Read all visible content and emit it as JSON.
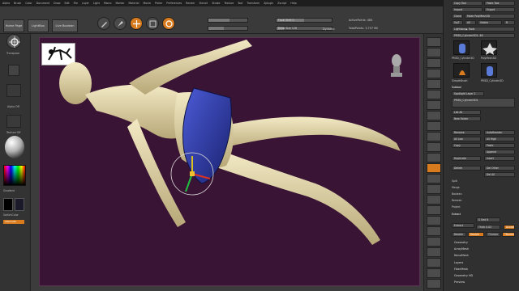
{
  "menubar": {
    "items": [
      "Alpha",
      "Brush",
      "Color",
      "Document",
      "Draw",
      "Edit",
      "File",
      "Layer",
      "Light",
      "Macro",
      "Marker",
      "Material",
      "Movie",
      "Picker",
      "Preferences",
      "Render",
      "Stencil",
      "Stroke",
      "Texture",
      "Tool",
      "Transform",
      "Zplugin",
      "Zscript",
      "Help"
    ]
  },
  "topbar": {
    "home_page": "Home Page",
    "lightbox": "LightBox",
    "live_boolean": "Live Boolean",
    "focal_shift_label": "Focal Shift 0",
    "focal_shift_value": 0,
    "draw_size_label": "Draw Size 128",
    "draw_size_fraction": 0.13,
    "dynamic_label": "Dynamic",
    "active_points": "ActivePoints: 484",
    "total_points": "TotalPoints: 3.757 Mil"
  },
  "left_shelf": {
    "transpose_label": "Transpose",
    "alpha_off": "Alpha Off",
    "texture_off": "Texture Off",
    "gradient_label": "Gradient",
    "switch_color": "SwitchColor",
    "alternate": "Alternate"
  },
  "right_tray": {
    "copy_tool": "Copy Tool",
    "paste_tool": "Paste Tool",
    "import": "Import",
    "export": "Export",
    "clone": "Clone",
    "make_polymesh": "Make PolyMesh3D",
    "goz": "GoZ",
    "all": "All",
    "visible": "Visible",
    "r": "R",
    "lightbox_tools": "Lightbox ▶ Tools",
    "current_tool": "PM3D_Cylinder3D1. 48",
    "thumb_labels": [
      "PM3D_Cylinder3D",
      "PolyMesh3D",
      "SimpleBrush",
      "PM3D_Cylinder3D"
    ],
    "subtool": "Subtool",
    "spotlight": "Spotlight Layer 1",
    "subtool_item": "PM3D_Cylinder3D1",
    "list_all": "List All",
    "new_folder": "New Folder",
    "rename": "Rename",
    "auto_reorder": "AutoReorder",
    "all_low": "All Low",
    "all_high": "All High",
    "copy": "Copy",
    "paste": "Paste",
    "duplicate": "Duplicate",
    "append": "Append",
    "insert": "Insert",
    "delete": "Delete",
    "del_other": "Del Other",
    "del_all": "Del All",
    "split": "Split",
    "merge": "Merge",
    "boolean": "Boolean",
    "remesh": "Remesh",
    "project": "Project",
    "extract": "Extract",
    "s_smt": "S Smt 6",
    "thick": "Thick 0.02",
    "accept": "Accept",
    "double": "Double",
    "tcorner": "TCorner",
    "tborder": "TBorder",
    "menu": [
      "Geometry",
      "ArrayMesh",
      "NanoMesh",
      "Layers",
      "FiberMesh",
      "Geometry HD",
      "Preview"
    ]
  },
  "canvas": {
    "figure": "3D human mannequin lying on back with blue shorts mesh",
    "background_color": "#3a1434"
  },
  "colors": {
    "accent": "#d77b1e",
    "canvas_bg": "#3a1434",
    "mesh": "#e2d6a8",
    "shorts": "#2d3aa8"
  }
}
